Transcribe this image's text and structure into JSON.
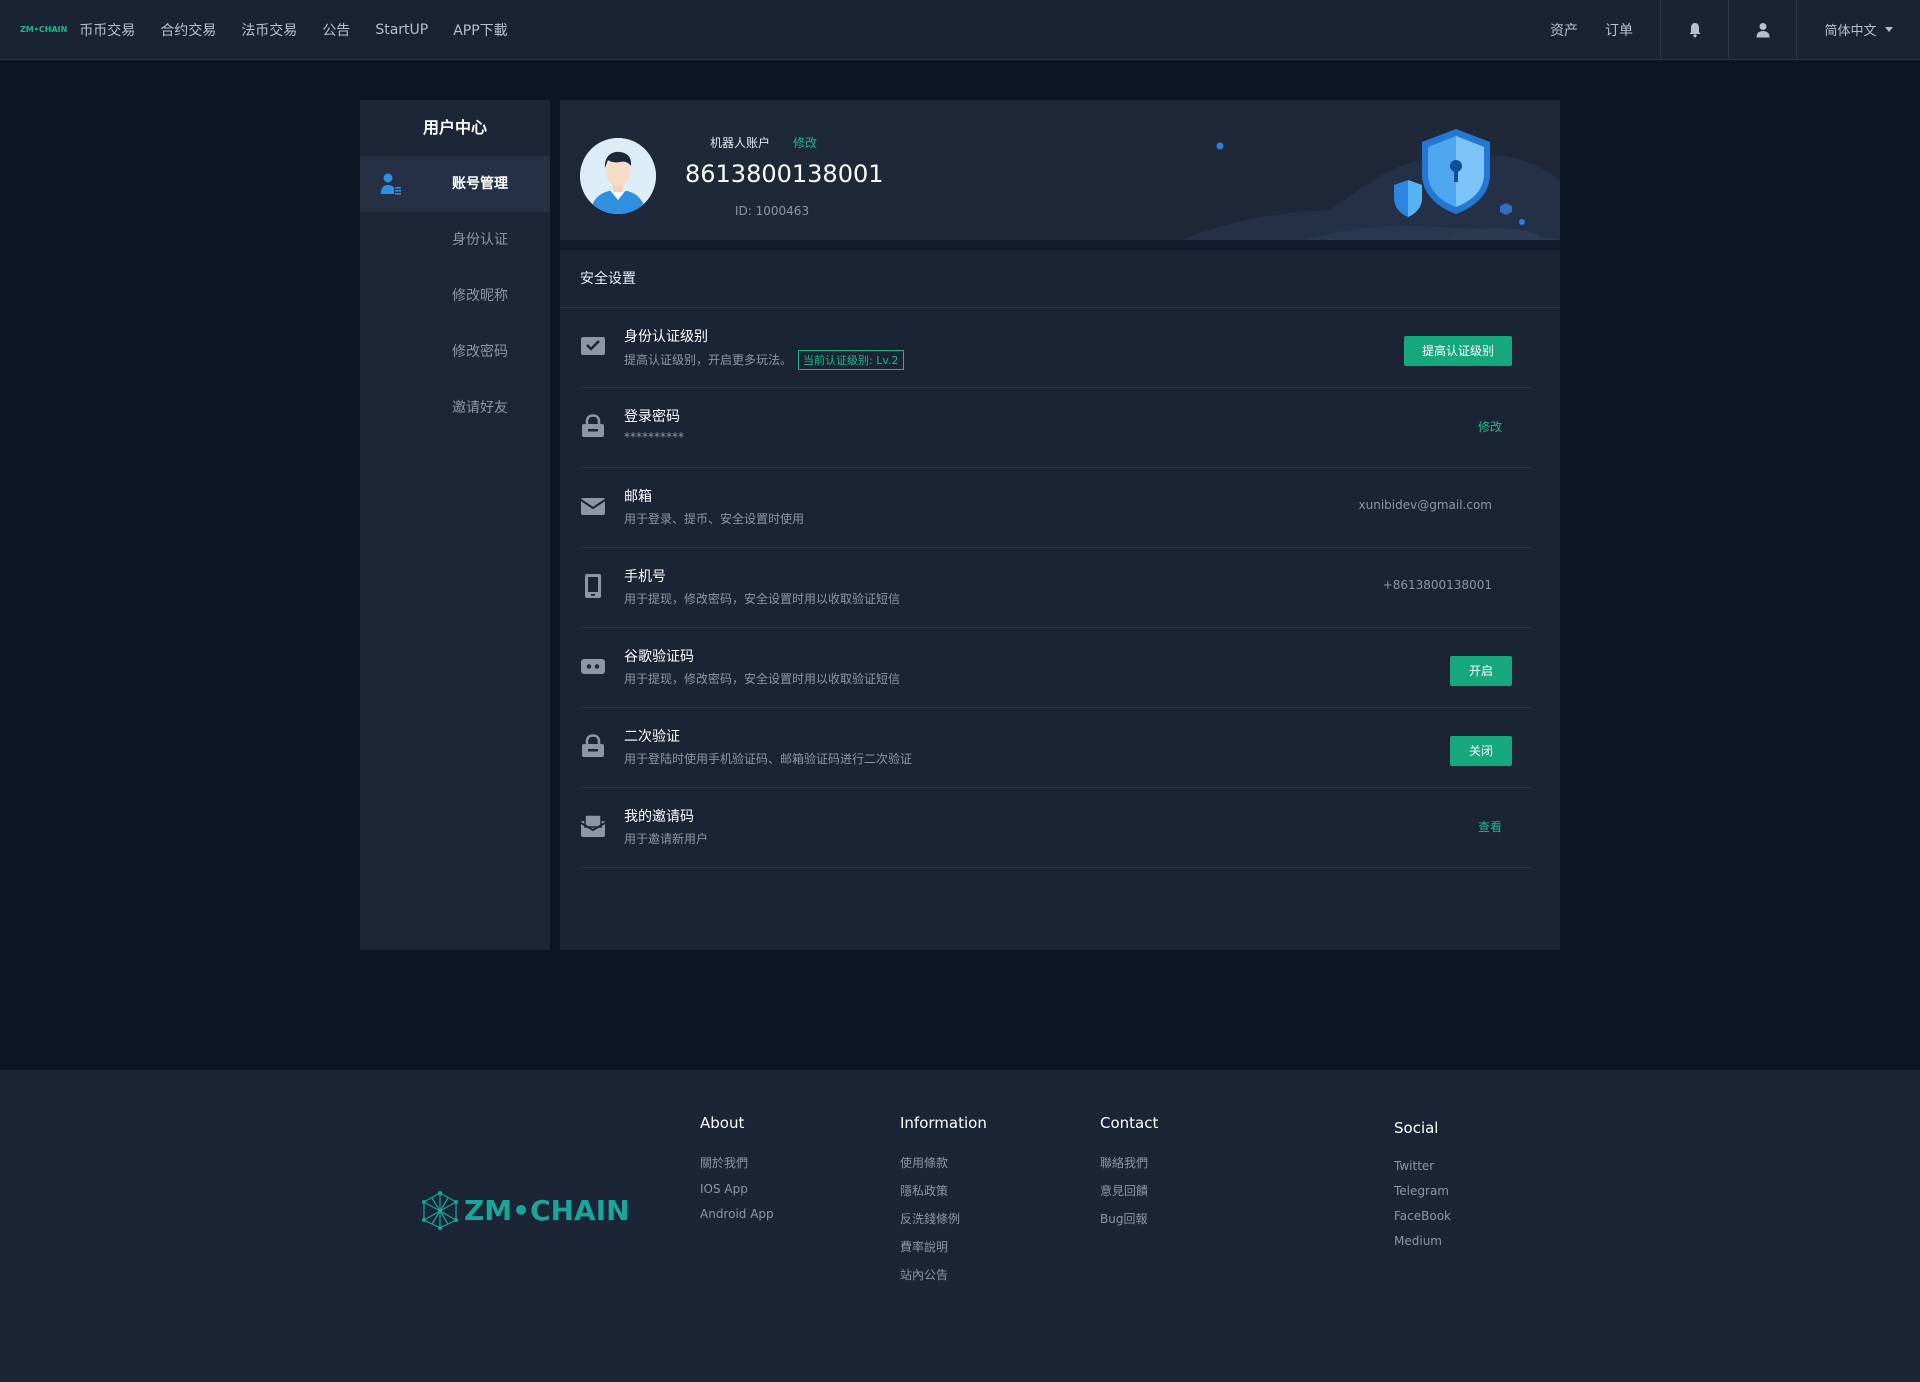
{
  "nav": {
    "logo_text": "ZM•CHAIN",
    "links": [
      "币币交易",
      "合约交易",
      "法币交易",
      "公告",
      "StartUP",
      "APP下載"
    ],
    "assets": "资产",
    "orders": "订单",
    "language": "简体中文"
  },
  "sidebar": {
    "title": "用户中心",
    "items": [
      {
        "label": "账号管理",
        "active": true
      },
      {
        "label": "身份认证"
      },
      {
        "label": "修改昵称"
      },
      {
        "label": "修改密码"
      },
      {
        "label": "邀请好友"
      }
    ]
  },
  "profile": {
    "account_type": "机器人账户",
    "edit_label": "修改",
    "phone": "8613800138001",
    "id_text": "ID: 1000463"
  },
  "security": {
    "title": "安全设置",
    "rows": [
      {
        "title": "身份认证级别",
        "desc": "提高认证级别，开启更多玩法。",
        "badge": "当前认证级别: Lv.2",
        "action": "提高认证级别"
      },
      {
        "title": "登录密码",
        "desc": "**********",
        "action": "修改"
      },
      {
        "title": "邮箱",
        "desc": "用于登录、提币、安全设置时使用",
        "value": "xunibidev@gmail.com"
      },
      {
        "title": "手机号",
        "desc": "用于提现，修改密码，安全设置时用以收取验证短信",
        "value": "+8613800138001"
      },
      {
        "title": "谷歌验证码",
        "desc": "用于提现，修改密码，安全设置时用以收取验证短信",
        "action": "开启"
      },
      {
        "title": "二次验证",
        "desc": "用于登陆时使用手机验证码、邮箱验证码进行二次验证",
        "action": "关闭"
      },
      {
        "title": "我的邀请码",
        "desc": "用于邀请新用户",
        "action": "查看"
      }
    ]
  },
  "footer": {
    "logo_text": "ZM•CHAIN",
    "about": {
      "title": "About",
      "links": [
        "關於我們",
        "IOS App",
        "Android App"
      ]
    },
    "information": {
      "title": "Information",
      "links": [
        "使用條款",
        "隱私政策",
        "反洗錢條例",
        "費率說明",
        "站內公告"
      ]
    },
    "contact": {
      "title": "Contact",
      "links": [
        "聯絡我們",
        "意見回饋",
        "Bug回報"
      ]
    },
    "social": {
      "title": "Social",
      "links": [
        "Twitter",
        "Telegram",
        "FaceBook",
        "Medium"
      ]
    }
  },
  "colors": {
    "accent": "#1db887",
    "button": "#16a77c",
    "bg": "#0c1524",
    "panel": "#1b2435",
    "footer_logo": "#19a59c"
  }
}
